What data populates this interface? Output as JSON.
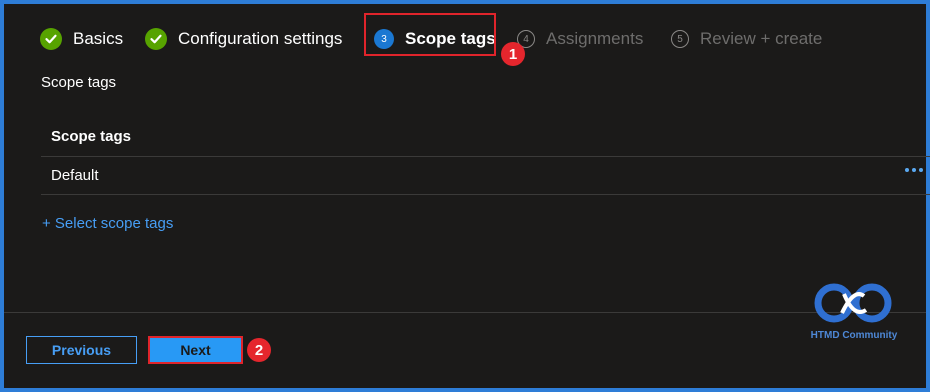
{
  "wizard": {
    "steps": [
      {
        "label": "Basics",
        "state": "complete",
        "icon": "check-icon"
      },
      {
        "label": "Configuration settings",
        "state": "complete",
        "icon": "check-icon"
      },
      {
        "label": "Scope tags",
        "number": "3",
        "state": "current"
      },
      {
        "label": "Assignments",
        "number": "4",
        "state": "upcoming"
      },
      {
        "label": "Review + create",
        "number": "5",
        "state": "upcoming"
      }
    ]
  },
  "callouts": {
    "one": "1",
    "two": "2"
  },
  "section": {
    "title": "Scope tags"
  },
  "table": {
    "header": "Scope tags",
    "rows": [
      {
        "name": "Default",
        "actions_icon": "more-icon"
      }
    ]
  },
  "select_link": "+ Select scope tags",
  "footer": {
    "previous_label": "Previous",
    "next_label": "Next"
  },
  "logo": {
    "text": "HTMD Community"
  },
  "colors": {
    "accent": "#2899f5",
    "link": "#479ef5",
    "success": "#57a300",
    "annotation_red": "#e0242b",
    "background": "#1b1a19",
    "border": "#2e7dd7"
  }
}
